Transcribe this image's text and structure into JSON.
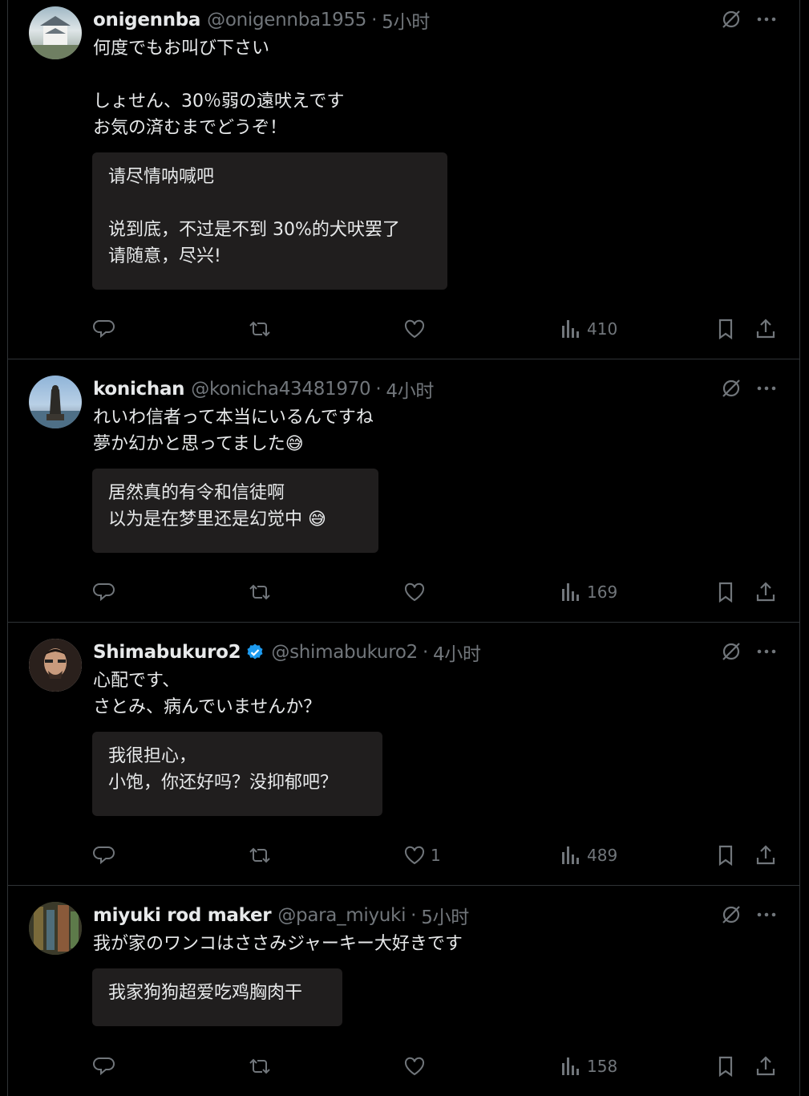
{
  "tweets": [
    {
      "name": "onigennba",
      "handle": "@onigennba1955",
      "time": "5小时",
      "verified": false,
      "text": "何度でもお叫び下さい\n\nしょせん、30％弱の遠吠えです\nお気の済むまでどうぞ！",
      "translation": "请尽情呐喊吧\n\n说到底，不过是不到 30%的犬吠罢了\n请随意，尽兴!",
      "likes": "",
      "views": "410",
      "avatar_color": "#c9d3d6"
    },
    {
      "name": "konichan",
      "handle": "@konicha43481970",
      "time": "4小时",
      "verified": false,
      "text": "れいわ信者って本当にいるんですね\n夢か幻かと思ってました😅",
      "translation": "居然真的有令和信徒啊\n以为是在梦里还是幻觉中 😅",
      "likes": "",
      "views": "169",
      "avatar_color": "#5e7d9e"
    },
    {
      "name": "Shimabukuro2",
      "handle": "@shimabukuro2",
      "time": "4小时",
      "verified": true,
      "text": "心配です、\nさとみ、病んでいませんか？",
      "translation": "我很担心，\n小饱，你还好吗？没抑郁吧？",
      "likes": "1",
      "views": "489",
      "avatar_color": "#3a2a22"
    },
    {
      "name": "miyuki rod maker",
      "handle": "@para_miyuki",
      "time": "5小时",
      "verified": false,
      "text": "我が家のワンコはささみジャーキー大好きです",
      "translation": "我家狗狗超爱吃鸡胸肉干",
      "likes": "",
      "views": "158",
      "avatar_color": "#4a5a3a"
    }
  ],
  "icons": {
    "grok": "grok-icon",
    "more": "more-icon",
    "reply": "reply-icon",
    "retweet": "retweet-icon",
    "like": "like-icon",
    "views": "views-icon",
    "bookmark": "bookmark-icon",
    "share": "share-icon"
  },
  "colors": {
    "background": "#000000",
    "text": "#e7e9ea",
    "muted": "#71767b",
    "verified": "#1d9bf0",
    "translation_bg": "#201e1e"
  }
}
